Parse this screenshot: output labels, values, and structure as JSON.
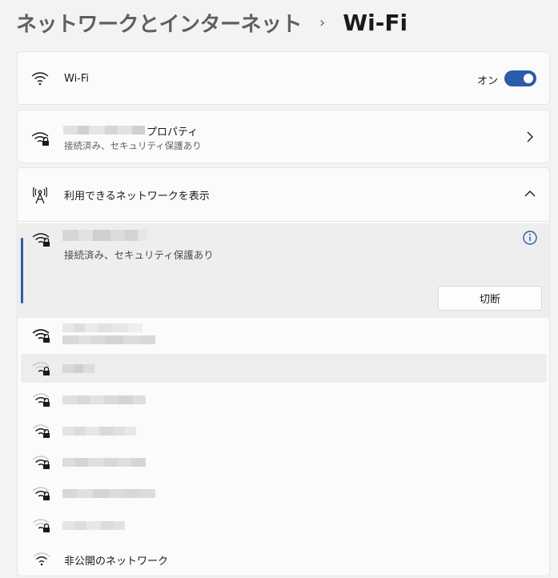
{
  "breadcrumb": {
    "parent": "ネットワークとインターネット",
    "separator": "›",
    "current": "Wi-Fi"
  },
  "wifi_toggle": {
    "label": "Wi-Fi",
    "state_label": "オン",
    "on": true
  },
  "properties": {
    "name_suffix": "プロパティ",
    "status": "接続済み、セキュリティ保護あり"
  },
  "available": {
    "label": "利用できるネットワークを表示"
  },
  "connected_network": {
    "status": "接続済み、セキュリティ保護あり",
    "disconnect_label": "切断"
  },
  "hidden_network": {
    "label": "非公開のネットワーク"
  },
  "colors": {
    "accent": "#2a5cab",
    "background": "#f3f3f3",
    "card": "#fbfbfb"
  },
  "icons": [
    "wifi-icon",
    "wifi-lock-icon",
    "chevron-right-icon",
    "chevron-up-icon",
    "antenna-icon",
    "info-icon"
  ]
}
